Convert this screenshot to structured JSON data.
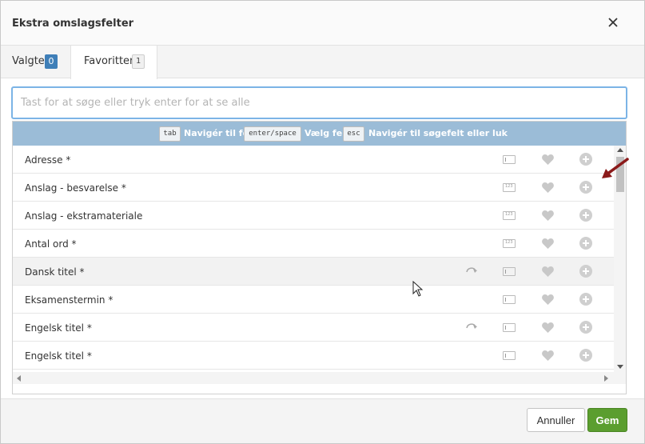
{
  "header": {
    "title": "Ekstra omslagsfelter",
    "close_icon": "close-icon"
  },
  "tabs": [
    {
      "label": "Valgte",
      "count": "0"
    },
    {
      "label": "Favoritter",
      "count": "1"
    }
  ],
  "search": {
    "placeholder": "Tast for at søge eller tryk enter for at se alle",
    "value": ""
  },
  "hint": {
    "items": [
      {
        "key": "tab",
        "text": "Navigér til felt"
      },
      {
        "key": "enter/space",
        "text": "Vælg felt"
      },
      {
        "key": "esc",
        "text": "Navigér til søgefelt eller luk"
      }
    ]
  },
  "rows": [
    {
      "name": "Adresse *",
      "linked": false,
      "field_icon": "text-field-icon",
      "highlighted": false
    },
    {
      "name": "Anslag - besvarelse *",
      "linked": false,
      "field_icon": "number-field-icon",
      "highlighted": false
    },
    {
      "name": "Anslag - ekstramateriale",
      "linked": false,
      "field_icon": "number-field-icon",
      "highlighted": false
    },
    {
      "name": "Antal ord *",
      "linked": false,
      "field_icon": "number-field-icon",
      "highlighted": false
    },
    {
      "name": "Dansk titel *",
      "linked": true,
      "field_icon": "text-field-icon",
      "highlighted": true
    },
    {
      "name": "Eksamenstermin *",
      "linked": false,
      "field_icon": "text-field-icon",
      "highlighted": false
    },
    {
      "name": "Engelsk titel *",
      "linked": true,
      "field_icon": "text-field-icon",
      "highlighted": false
    },
    {
      "name": "Engelsk titel *",
      "linked": false,
      "field_icon": "text-field-icon",
      "highlighted": false
    }
  ],
  "footer": {
    "cancel_label": "Annuller",
    "save_label": "Gem"
  },
  "colors": {
    "accent": "#3f7fb8",
    "save": "#5b9e2f",
    "hint_bar": "#9bbcd7",
    "search_border": "#7cb4e6",
    "annotation_arrow": "#8b1a1a"
  }
}
